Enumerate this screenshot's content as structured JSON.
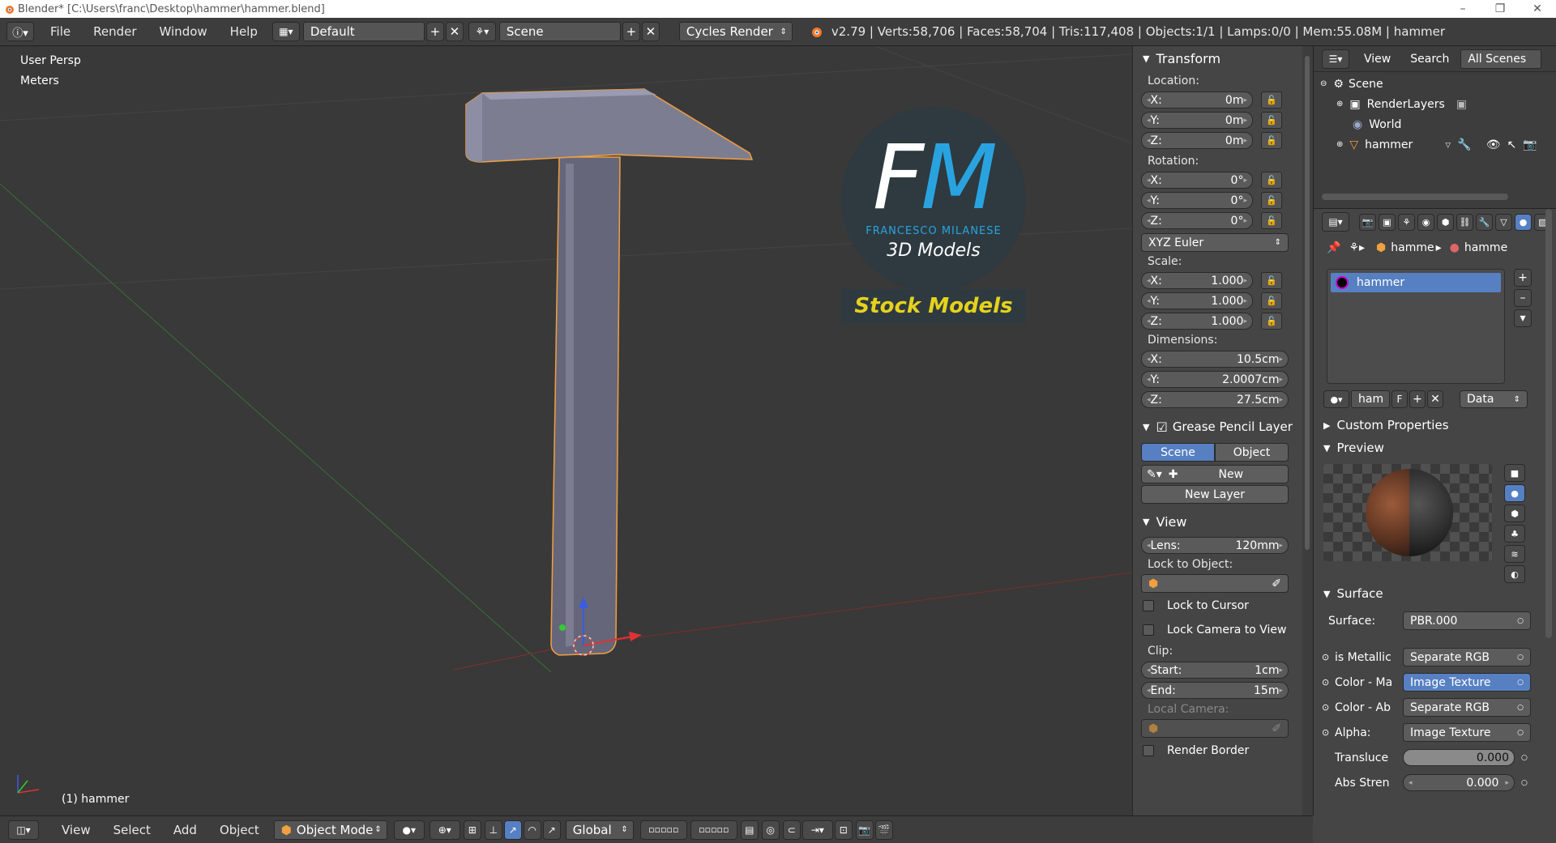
{
  "window": {
    "title": "Blender* [C:\\Users\\franc\\Desktop\\hammer\\hammer.blend]",
    "controls": [
      "–",
      "❐",
      "✕"
    ]
  },
  "infobar": {
    "menus": [
      "File",
      "Render",
      "Window",
      "Help"
    ],
    "layout": "Default",
    "scene": "Scene",
    "engine": "Cycles Render",
    "stats": "v2.79 | Verts:58,706 | Faces:58,704 | Tris:117,408 | Objects:1/1 | Lamps:0/0 | Mem:55.08M | hammer"
  },
  "viewport": {
    "view_name": "User Persp",
    "units": "Meters",
    "object_label": "(1) hammer",
    "logo": {
      "letters": "FM",
      "author": "FRANCESCO MILANESE",
      "subtitle": "3D Models",
      "banner": "Stock Models"
    }
  },
  "transform": {
    "header": "Transform",
    "location_label": "Location:",
    "location": [
      {
        "k": "X:",
        "v": "0m"
      },
      {
        "k": "Y:",
        "v": "0m"
      },
      {
        "k": "Z:",
        "v": "0m"
      }
    ],
    "rotation_label": "Rotation:",
    "rotation": [
      {
        "k": "X:",
        "v": "0°"
      },
      {
        "k": "Y:",
        "v": "0°"
      },
      {
        "k": "Z:",
        "v": "0°"
      }
    ],
    "rotation_mode": "XYZ Euler",
    "scale_label": "Scale:",
    "scale": [
      {
        "k": "X:",
        "v": "1.000"
      },
      {
        "k": "Y:",
        "v": "1.000"
      },
      {
        "k": "Z:",
        "v": "1.000"
      }
    ],
    "dimensions_label": "Dimensions:",
    "dimensions": [
      {
        "k": "X:",
        "v": "10.5cm"
      },
      {
        "k": "Y:",
        "v": "2.0007cm"
      },
      {
        "k": "Z:",
        "v": "27.5cm"
      }
    ]
  },
  "grease_pencil": {
    "header": "Grease Pencil Layer",
    "tab_scene": "Scene",
    "tab_object": "Object",
    "new_label": "New",
    "new_layer_label": "New Layer"
  },
  "view_panel": {
    "header": "View",
    "lens": {
      "k": "Lens:",
      "v": "120mm"
    },
    "lock_to_object": "Lock to Object:",
    "lock_to_cursor": "Lock to Cursor",
    "lock_camera": "Lock Camera to View",
    "clip_label": "Clip:",
    "clip_start": {
      "k": "Start:",
      "v": "1cm"
    },
    "clip_end": {
      "k": "End:",
      "v": "15m"
    },
    "local_camera": "Local Camera:",
    "render_border": "Render Border"
  },
  "outliner": {
    "header_items": [
      "View",
      "Search"
    ],
    "filter": "All Scenes",
    "tree": [
      "Scene",
      "RenderLayers",
      "World",
      "hammer"
    ]
  },
  "properties": {
    "breadcrumb": [
      "hamme",
      "hamme"
    ],
    "material_slot": "hammer",
    "material_name": "ham",
    "fake_user": "F",
    "link": "Data",
    "custom_properties": "Custom Properties",
    "preview": "Preview",
    "surface_header": "Surface",
    "surface": {
      "label": "Surface:",
      "value": "PBR.000"
    },
    "inputs": [
      {
        "label": "is Metallic",
        "value": "Separate RGB"
      },
      {
        "label": "Color - Ma",
        "value": "Image Texture"
      },
      {
        "label": "Color - Ab",
        "value": "Separate RGB"
      },
      {
        "label": "Alpha:",
        "value": "Image Texture"
      }
    ],
    "translucence": {
      "label": "Transluce",
      "value": "0.000"
    },
    "abs_strength": {
      "label": "Abs Stren",
      "value": "0.000"
    }
  },
  "bottombar": {
    "menus": [
      "View",
      "Select",
      "Add",
      "Object"
    ],
    "mode": "Object Mode",
    "orientation": "Global"
  },
  "colors": {
    "accent_blue": "#5680c2",
    "selection_orange": "#f0a040",
    "logo_blue": "#29a3e0",
    "banner_yellow": "#e6d21c"
  }
}
